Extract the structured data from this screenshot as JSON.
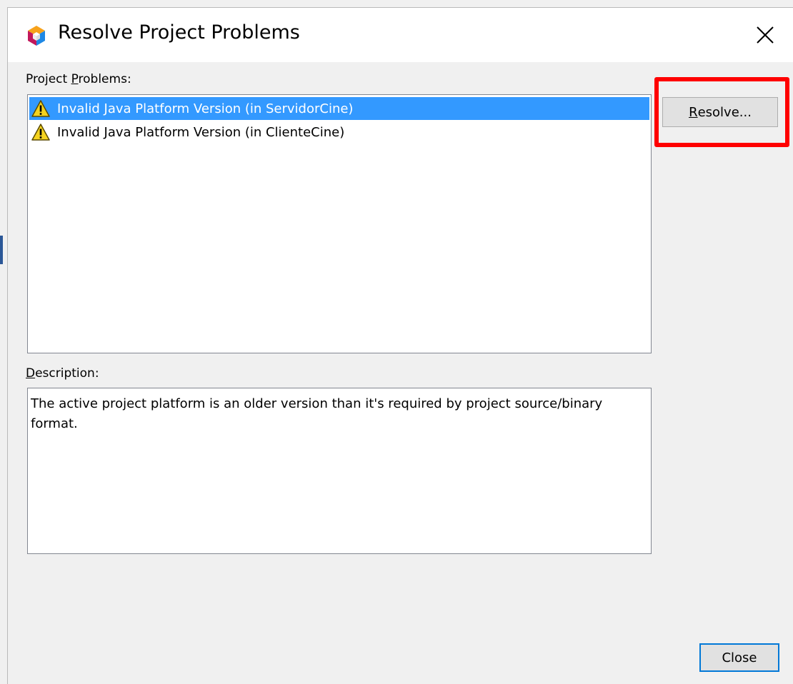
{
  "dialog": {
    "title": "Resolve Project Problems"
  },
  "problems_section": {
    "label_prefix": "Project ",
    "label_mnemonic": "P",
    "label_suffix": "roblems:",
    "items": [
      {
        "label": "Invalid Java Platform Version (in ServidorCine)",
        "selected": true,
        "icon": "warning-icon"
      },
      {
        "label": "Invalid Java Platform Version (in ClienteCine)",
        "selected": false,
        "icon": "warning-icon"
      }
    ]
  },
  "description_section": {
    "label_mnemonic": "D",
    "label_suffix": "escription:",
    "text": "The active project platform is an older version than it's required by project source/binary format."
  },
  "buttons": {
    "resolve_mnemonic": "R",
    "resolve_suffix": "esolve...",
    "close_label": "Close"
  },
  "colors": {
    "selection": "#3399ff",
    "highlight": "#ff0000",
    "focus_border": "#0078d7"
  }
}
